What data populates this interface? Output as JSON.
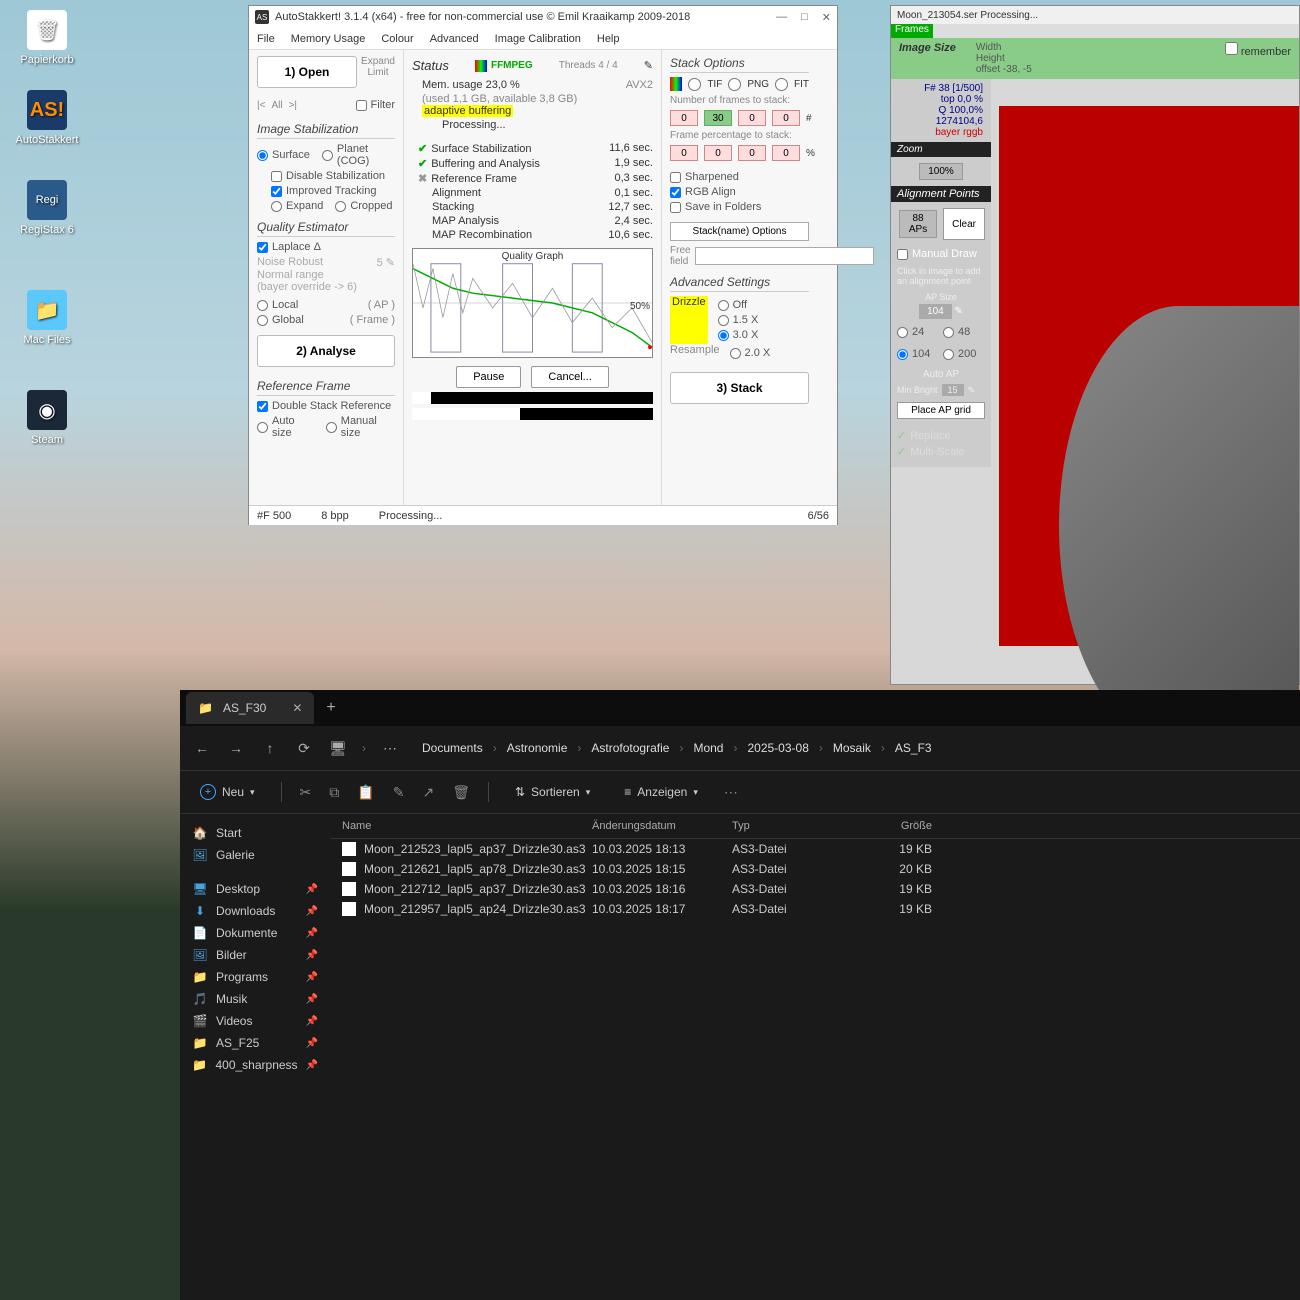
{
  "desktop": {
    "icons": [
      {
        "label": "Papierkorb"
      },
      {
        "label": "AutoStakkert"
      },
      {
        "label": "RegiStax 6"
      },
      {
        "label": "Mac Files"
      },
      {
        "label": "Steam"
      }
    ]
  },
  "as": {
    "title": "AutoStakkert! 3.1.4 (x64) - free for non-commercial use © Emil Kraaikamp 2009-2018",
    "menu": [
      "File",
      "Memory Usage",
      "Colour",
      "Advanced",
      "Image Calibration",
      "Help"
    ],
    "col1": {
      "open": "1) Open",
      "expand": "Expand",
      "limit": "Limit",
      "navbtns": [
        "|<",
        "All",
        ">|"
      ],
      "filter": "Filter",
      "stab_t": "Image Stabilization",
      "surface": "Surface",
      "planet": "Planet (COG)",
      "disable": "Disable Stabilization",
      "improved": "Improved Tracking",
      "expand2": "Expand",
      "cropped": "Cropped",
      "qe_t": "Quality Estimator",
      "laplace": "Laplace Δ",
      "noise": "Noise Robust",
      "noise_v": "5",
      "normal": "Normal range",
      "bayer": "(bayer override -> 6)",
      "local": "Local",
      "ap": "( AP )",
      "global": "Global",
      "frame": "( Frame )",
      "analyse": "2) Analyse",
      "ref_t": "Reference Frame",
      "double": "Double Stack Reference",
      "auto": "Auto size",
      "manual": "Manual size"
    },
    "col2": {
      "status": "Status",
      "ffmpeg": "FFMPEG",
      "threads": "Threads 4 / 4",
      "mem": "Mem. usage 23,0 %",
      "used": "(used 1,1 GB, available 3,8 GB)",
      "avx": "AVX2",
      "adaptive": "adaptive buffering",
      "processing": "Processing...",
      "timings": [
        {
          "n": "Surface Stabilization",
          "v": "11,6 sec.",
          "c": "g"
        },
        {
          "n": "Buffering and Analysis",
          "v": "1,9 sec.",
          "c": "g"
        },
        {
          "n": "Reference Frame",
          "v": "0,3 sec.",
          "c": "x"
        },
        {
          "n": "Alignment",
          "v": "0,1 sec.",
          "c": ""
        },
        {
          "n": "Stacking",
          "v": "12,7 sec.",
          "c": ""
        },
        {
          "n": "MAP Analysis",
          "v": "2,4 sec.",
          "c": ""
        },
        {
          "n": "MAP Recombination",
          "v": "10,6 sec.",
          "c": ""
        }
      ],
      "graph_t": "Quality Graph",
      "fifty": "50%",
      "pause": "Pause",
      "cancel": "Cancel...",
      "p1": "8%",
      "p2": "45%"
    },
    "col3": {
      "stack_t": "Stack Options",
      "tif": "TIF",
      "png": "PNG",
      "fit": "FIT",
      "nframes": "Number of frames to stack:",
      "nvals": [
        "0",
        "30",
        "0",
        "0"
      ],
      "hash": "#",
      "fperc": "Frame percentage to stack:",
      "pvals": [
        "0",
        "0",
        "0",
        "0"
      ],
      "pct": "%",
      "sharp": "Sharpened",
      "rgb": "RGB Align",
      "save": "Save in Folders",
      "stackname": "Stack(name) Options",
      "free": "Free field",
      "adv_t": "Advanced Settings",
      "drizzle": "Drizzle",
      "off": "Off",
      "x15": "1.5 X",
      "x30": "3.0 X",
      "resample": "Resample",
      "x20": "2.0 X",
      "stack_btn": "3) Stack"
    },
    "status": {
      "f": "#F 500",
      "bpp": "8 bpp",
      "proc": "Processing...",
      "prog": "6/56"
    }
  },
  "ap": {
    "title": "Moon_213054.ser    Processing...",
    "frames": "Frames",
    "image_size": "Image Size",
    "width": "Width",
    "height": "Height",
    "offset": "offset",
    "off_v": "-38, -5",
    "remember": "remember",
    "f38": "F# 38 [1/500]",
    "top": "top 0,0 %",
    "q": "Q 100,0%  1274104,6",
    "bayer": "bayer rggb",
    "zoom": "Zoom",
    "z100": "100%",
    "align_t": "Alignment Points",
    "aps": "88 APs",
    "clear": "Clear",
    "manual": "Manual Draw",
    "hint": "Click in image to add an alignment point",
    "apsize": "AP Size",
    "r24": "24",
    "r48": "48",
    "r104": "104",
    "r200": "200",
    "size104": "104",
    "autoap": "Auto AP",
    "minb": "Min Bright",
    "minb_v": "15",
    "place": "Place AP grid",
    "replace": "Replace",
    "multi": "Multi-Scale"
  },
  "explorer": {
    "tab": "AS_F30",
    "breadcrumb": [
      "Documents",
      "Astronomie",
      "Astrofotografie",
      "Mond",
      "2025-03-08",
      "Mosaik",
      "AS_F3"
    ],
    "toolbar": {
      "neu": "Neu",
      "sort": "Sortieren",
      "view": "Anzeigen"
    },
    "sidebar_top": [
      {
        "ico": "🏠",
        "label": "Start",
        "color": "#ff8c00"
      },
      {
        "ico": "🖼",
        "label": "Galerie",
        "color": "#4aa3df"
      }
    ],
    "sidebar": [
      {
        "ico": "🖥",
        "label": "Desktop",
        "c": "#4aa3df"
      },
      {
        "ico": "⬇",
        "label": "Downloads",
        "c": "#4aa3df"
      },
      {
        "ico": "📄",
        "label": "Dokumente",
        "c": "#4aa3df"
      },
      {
        "ico": "🖼",
        "label": "Bilder",
        "c": "#4aa3df"
      },
      {
        "ico": "📁",
        "label": "Programs",
        "c": "#ffc040"
      },
      {
        "ico": "🎵",
        "label": "Musik",
        "c": "#e74c8c"
      },
      {
        "ico": "🎬",
        "label": "Videos",
        "c": "#4aa3df"
      },
      {
        "ico": "📁",
        "label": "AS_F25",
        "c": "#ffc040"
      },
      {
        "ico": "📁",
        "label": "400_sharpness",
        "c": "#ffc040"
      }
    ],
    "cols": [
      "Name",
      "Änderungsdatum",
      "Typ",
      "Größe"
    ],
    "files": [
      {
        "n": "Moon_212523_lapl5_ap37_Drizzle30.as3",
        "d": "10.03.2025 18:13",
        "t": "AS3-Datei",
        "s": "19 KB"
      },
      {
        "n": "Moon_212621_lapl5_ap78_Drizzle30.as3",
        "d": "10.03.2025 18:15",
        "t": "AS3-Datei",
        "s": "20 KB"
      },
      {
        "n": "Moon_212712_lapl5_ap37_Drizzle30.as3",
        "d": "10.03.2025 18:16",
        "t": "AS3-Datei",
        "s": "19 KB"
      },
      {
        "n": "Moon_212957_lapl5_ap24_Drizzle30.as3",
        "d": "10.03.2025 18:17",
        "t": "AS3-Datei",
        "s": "19 KB"
      }
    ]
  }
}
